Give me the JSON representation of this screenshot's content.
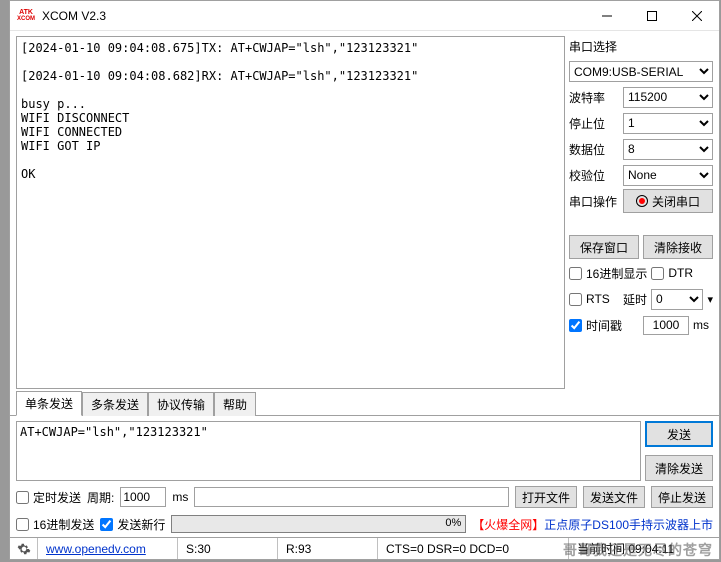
{
  "title": "XCOM V2.3",
  "icon_top": "ATK",
  "icon_bot": "XCOM",
  "log_text": "[2024-01-10 09:04:08.675]TX: AT+CWJAP=\"lsh\",\"123123321\"\n\n[2024-01-10 09:04:08.682]RX: AT+CWJAP=\"lsh\",\"123123321\"\n\nbusy p...\nWIFI DISCONNECT\nWIFI CONNECTED\nWIFI GOT IP\n\nOK\n",
  "right": {
    "section_title": "串口选择",
    "port": "COM9:USB-SERIAL",
    "baud_label": "波特率",
    "baud": "115200",
    "stop_label": "停止位",
    "stop": "1",
    "data_label": "数据位",
    "data": "8",
    "parity_label": "校验位",
    "parity": "None",
    "op_label": "串口操作",
    "op_btn": "关闭串口",
    "save_win": "保存窗口",
    "clear_recv": "清除接收",
    "hex_disp": "16进制显示",
    "dtr": "DTR",
    "rts": "RTS",
    "delay_label": "延时",
    "delay_val": "0",
    "timestamp": "时间戳",
    "ts_val": "1000",
    "ms": "ms"
  },
  "tabs": [
    "单条发送",
    "多条发送",
    "协议传输",
    "帮助"
  ],
  "active_tab": 0,
  "send_text": "AT+CWJAP=\"lsh\",\"123123321\"",
  "send_btn": "发送",
  "clear_send": "清除发送",
  "opts": {
    "timed_send": "定时发送",
    "period_label": "周期:",
    "period": "1000",
    "ms": "ms",
    "open_file": "打开文件",
    "send_file": "发送文件",
    "stop_send": "停止发送",
    "hex_send": "16进制发送",
    "send_newline": "发送新行",
    "progress": "0%"
  },
  "promo_hot": "【火爆全网】",
  "promo_rest": "正点原子DS100手持示波器上市",
  "status": {
    "url": "www.openedv.com",
    "s": "S:30",
    "r": "R:93",
    "signals": "CTS=0 DSR=0 DCD=0",
    "time": "当前时间 09:04:11"
  },
  "watermark": "哥哥我还是无尽的苍穹"
}
